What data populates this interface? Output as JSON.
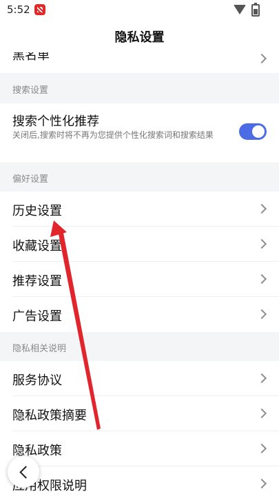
{
  "status_bar": {
    "time": "5:52"
  },
  "header": {
    "title": "隐私设置"
  },
  "partial_top_item": {
    "label": "黑名单"
  },
  "sections": {
    "search": {
      "title": "搜索设置",
      "item": {
        "label": "搜索个性化推荐",
        "description": "关闭后,搜索时将不再为您提供个性化搜索词和搜索结果",
        "toggle_on": true
      }
    },
    "preferences": {
      "title": "偏好设置",
      "items": [
        "历史设置",
        "收藏设置",
        "推荐设置",
        "广告设置"
      ]
    },
    "privacy_docs": {
      "title": "隐私相关说明",
      "items": [
        "服务协议",
        "隐私政策摘要",
        "隐私政策",
        "应用权限说明"
      ]
    }
  },
  "colors": {
    "accent": "#4b6ce5",
    "annotation_arrow": "#e0262c",
    "section_bg": "#f4f5f7"
  }
}
